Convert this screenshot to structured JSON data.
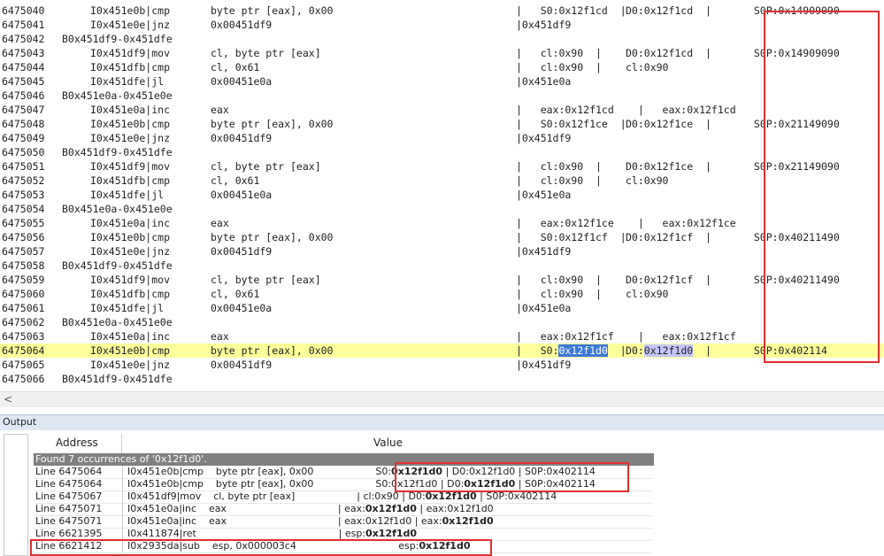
{
  "trace": {
    "rows": [
      {
        "num": "6475040",
        "addr": "I0x451e0b|cmp",
        "ops": "byte ptr [eax], 0x00",
        "s1": "|   S0:0x12f1cd  |",
        "s2": "D0:0x12f1cd  |",
        "s3": "  S0P:0x14909090"
      },
      {
        "num": "6475041",
        "addr": "I0x451e0e|jnz",
        "ops": "0x00451df9",
        "s1": "|0x451df9",
        "s2": "",
        "s3": ""
      },
      {
        "num": "6475042",
        "block": "B0x451df9-0x451dfe"
      },
      {
        "num": "6475043",
        "addr": "I0x451df9|mov",
        "ops": "cl, byte ptr [eax]",
        "s1": "|   cl:0x90  |",
        "s2": "D0:0x12f1cd  |",
        "s3": "  S0P:0x14909090"
      },
      {
        "num": "6475044",
        "addr": "I0x451dfb|cmp",
        "ops": "cl, 0x61",
        "s1": "|   cl:0x90  |",
        "s2": "cl:0x90",
        "s3": ""
      },
      {
        "num": "6475045",
        "addr": "I0x451dfe|jl",
        "ops": "0x00451e0a",
        "s1": "|0x451e0a",
        "s2": "",
        "s3": ""
      },
      {
        "num": "6475046",
        "block": "B0x451e0a-0x451e0e"
      },
      {
        "num": "6475047",
        "addr": "I0x451e0a|inc",
        "ops": "eax",
        "s1": "|   eax:0x12f1cd",
        "s2": "  |   eax:0x12f1cd",
        "s3": ""
      },
      {
        "num": "6475048",
        "addr": "I0x451e0b|cmp",
        "ops": "byte ptr [eax], 0x00",
        "s1": "|   S0:0x12f1ce  |",
        "s2": "D0:0x12f1ce  |",
        "s3": "  S0P:0x21149090"
      },
      {
        "num": "6475049",
        "addr": "I0x451e0e|jnz",
        "ops": "0x00451df9",
        "s1": "|0x451df9",
        "s2": "",
        "s3": ""
      },
      {
        "num": "6475050",
        "block": "B0x451df9-0x451dfe"
      },
      {
        "num": "6475051",
        "addr": "I0x451df9|mov",
        "ops": "cl, byte ptr [eax]",
        "s1": "|   cl:0x90  |",
        "s2": "D0:0x12f1ce  |",
        "s3": "  S0P:0x21149090"
      },
      {
        "num": "6475052",
        "addr": "I0x451dfb|cmp",
        "ops": "cl, 0x61",
        "s1": "|   cl:0x90  |",
        "s2": "cl:0x90",
        "s3": ""
      },
      {
        "num": "6475053",
        "addr": "I0x451dfe|jl",
        "ops": "0x00451e0a",
        "s1": "|0x451e0a",
        "s2": "",
        "s3": ""
      },
      {
        "num": "6475054",
        "block": "B0x451e0a-0x451e0e"
      },
      {
        "num": "6475055",
        "addr": "I0x451e0a|inc",
        "ops": "eax",
        "s1": "|   eax:0x12f1ce",
        "s2": "  |   eax:0x12f1ce",
        "s3": ""
      },
      {
        "num": "6475056",
        "addr": "I0x451e0b|cmp",
        "ops": "byte ptr [eax], 0x00",
        "s1": "|   S0:0x12f1cf  |",
        "s2": "D0:0x12f1cf  |",
        "s3": "  S0P:0x40211490"
      },
      {
        "num": "6475057",
        "addr": "I0x451e0e|jnz",
        "ops": "0x00451df9",
        "s1": "|0x451df9",
        "s2": "",
        "s3": ""
      },
      {
        "num": "6475058",
        "block": "B0x451df9-0x451dfe"
      },
      {
        "num": "6475059",
        "addr": "I0x451df9|mov",
        "ops": "cl, byte ptr [eax]",
        "s1": "|   cl:0x90  |",
        "s2": "D0:0x12f1cf  |",
        "s3": "  S0P:0x40211490"
      },
      {
        "num": "6475060",
        "addr": "I0x451dfb|cmp",
        "ops": "cl, 0x61",
        "s1": "|   cl:0x90  |",
        "s2": "cl:0x90",
        "s3": ""
      },
      {
        "num": "6475061",
        "addr": "I0x451dfe|jl",
        "ops": "0x00451e0a",
        "s1": "|0x451e0a",
        "s2": "",
        "s3": ""
      },
      {
        "num": "6475062",
        "block": "B0x451e0a-0x451e0e"
      },
      {
        "num": "6475063",
        "addr": "I0x451e0a|inc",
        "ops": "eax",
        "s1": "|   eax:0x12f1cf",
        "s2": "  |   eax:0x12f1cf",
        "s3": ""
      },
      {
        "num": "6475064",
        "addr": "I0x451e0b|cmp",
        "ops": "byte ptr [eax], 0x00",
        "s1": "|   S0:",
        "s1sel": "0x12f1d0",
        "s1tail": "  |",
        "s2": "D0:",
        "s2sel": "0x12f1d0",
        "s2tail": "  |",
        "s3": "  S0P:0x402114"
      },
      {
        "num": "6475065",
        "addr": "I0x451e0e|jnz",
        "ops": "0x00451df9",
        "s1": "|0x451df9",
        "s2": "",
        "s3": ""
      },
      {
        "num": "6475066",
        "block": "B0x451df9-0x451dfe"
      }
    ],
    "highlight_row": 24
  },
  "scrollbar": {
    "left_arrow": "<"
  },
  "output_panel": {
    "title": "Output",
    "col_address": "Address",
    "col_value": "Value",
    "found_text": "Found 7 occurrences of '0x12f1d0'.",
    "results": [
      {
        "line": "Line 6475064",
        "parts": [
          "I0x451e0b|cmp    byte ptr [eax], 0x00                    ",
          "S0:",
          "0x12f1d0",
          " | D0:0x12f1d0 | S0P:0x402114"
        ]
      },
      {
        "line": "Line 6475064",
        "parts": [
          "I0x451e0b|cmp    byte ptr [eax], 0x00                    ",
          "S0:0x12f1d0 | D0:",
          "0x12f1d0",
          " | S0P:0x402114"
        ]
      },
      {
        "line": "Line 6475067",
        "parts": [
          "I0x451df9|mov    cl, byte ptr [eax]                    | cl:0x90 | D0:",
          "0x12f1d0",
          " | S0P:0x402114"
        ]
      },
      {
        "line": "Line 6475071",
        "parts": [
          "I0x451e0a|inc    eax                                    | eax:",
          "0x12f1d0",
          " | eax:0x12f1d0"
        ]
      },
      {
        "line": "Line 6475071",
        "parts": [
          "I0x451e0a|inc    eax                                    | eax:0x12f1d0 | eax:",
          "0x12f1d0",
          ""
        ]
      },
      {
        "line": "Line 6621395",
        "parts": [
          "I0x411874|ret                                              | esp:",
          "0x12f1d0",
          ""
        ]
      },
      {
        "line": "Line 6621412",
        "parts": [
          "I0x2935da|sub    esp, 0x000003c4                                 esp:",
          "0x12f1d0",
          ""
        ]
      }
    ]
  },
  "colors": {
    "highlight": "#ffff9c",
    "annotation_red": "#e03030",
    "selection": "#3b78d8"
  }
}
